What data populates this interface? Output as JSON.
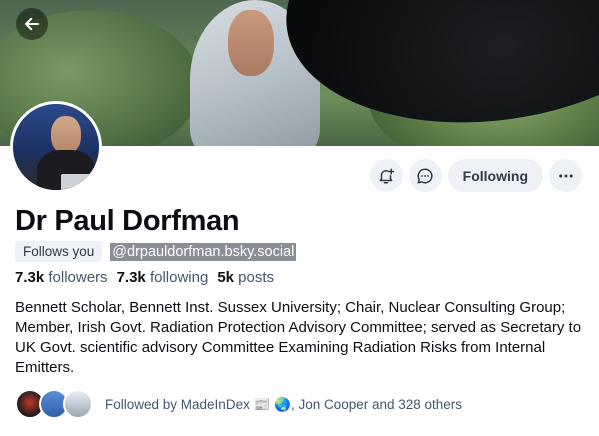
{
  "profile": {
    "display_name": "Dr Paul Dorfman",
    "follows_you": "Follows you",
    "handle": "@drpauldorfman.bsky.social",
    "followers_count": "7.3k",
    "followers_label": "followers",
    "following_count": "7.3k",
    "following_label": "following",
    "posts_count": "5k",
    "posts_label": "posts",
    "bio": "Bennett Scholar, Bennett Inst. Sussex University; Chair, Nuclear Consulting Group; Member, Irish Govt. Radiation Protection Advisory Committee; served as Secretary to UK Govt. scientific advisory Committee Examining Radiation Risks from Internal Emitters.",
    "followed_by": "Followed by MadeInDex 📰 🌏, Jon Cooper and 328 others"
  },
  "actions": {
    "following_label": "Following"
  },
  "icons": {
    "back": "back-arrow-icon",
    "notify": "bell-plus-icon",
    "message": "chat-bubble-icon",
    "more": "ellipsis-icon"
  },
  "colors": {
    "button_bg": "#eef1f5",
    "text_secondary": "#42576c"
  }
}
